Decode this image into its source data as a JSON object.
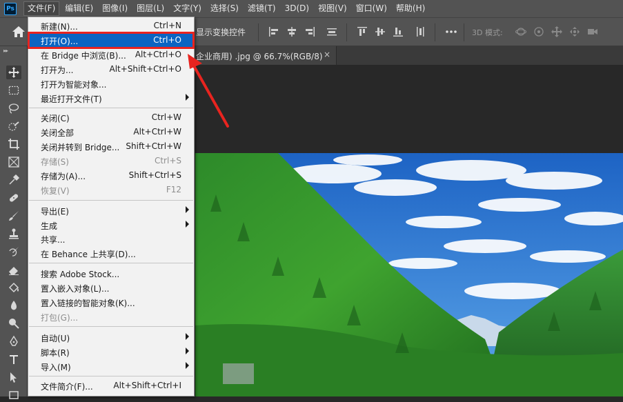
{
  "app": {
    "logo_text": "Ps"
  },
  "menubar": {
    "items": [
      "文件(F)",
      "编辑(E)",
      "图像(I)",
      "图层(L)",
      "文字(Y)",
      "选择(S)",
      "滤镜(T)",
      "3D(D)",
      "视图(V)",
      "窗口(W)",
      "帮助(H)"
    ],
    "active_index": 0
  },
  "options": {
    "transform_controls_label": "显示变换控件",
    "threed_mode_label": "3D 模式:"
  },
  "document_tab": {
    "title": "企业商用) .jpg @ 66.7%(RGB/8)",
    "close_label": "×"
  },
  "file_menu": {
    "items": [
      {
        "label": "新建(N)...",
        "shortcut": "Ctrl+N"
      },
      {
        "label": "打开(O)...",
        "shortcut": "Ctrl+O",
        "highlighted": true
      },
      {
        "label": "在 Bridge 中浏览(B)...",
        "shortcut": "Alt+Ctrl+O"
      },
      {
        "label": "打开为...",
        "shortcut": "Alt+Shift+Ctrl+O"
      },
      {
        "label": "打开为智能对象...",
        "shortcut": ""
      },
      {
        "label": "最近打开文件(T)",
        "shortcut": "",
        "submenu": true
      },
      {
        "label": "关闭(C)",
        "shortcut": "Ctrl+W"
      },
      {
        "label": "关闭全部",
        "shortcut": "Alt+Ctrl+W"
      },
      {
        "label": "关闭并转到 Bridge...",
        "shortcut": "Shift+Ctrl+W"
      },
      {
        "label": "存储(S)",
        "shortcut": "Ctrl+S",
        "disabled": true
      },
      {
        "label": "存储为(A)...",
        "shortcut": "Shift+Ctrl+S"
      },
      {
        "label": "恢复(V)",
        "shortcut": "F12",
        "disabled": true
      },
      {
        "label": "导出(E)",
        "shortcut": "",
        "submenu": true
      },
      {
        "label": "生成",
        "shortcut": "",
        "submenu": true
      },
      {
        "label": "共享...",
        "shortcut": ""
      },
      {
        "label": "在 Behance 上共享(D)...",
        "shortcut": ""
      },
      {
        "label": "搜索 Adobe Stock...",
        "shortcut": ""
      },
      {
        "label": "置入嵌入对象(L)...",
        "shortcut": ""
      },
      {
        "label": "置入链接的智能对象(K)...",
        "shortcut": ""
      },
      {
        "label": "打包(G)...",
        "shortcut": "",
        "disabled": true
      },
      {
        "label": "自动(U)",
        "shortcut": "",
        "submenu": true
      },
      {
        "label": "脚本(R)",
        "shortcut": "",
        "submenu": true
      },
      {
        "label": "导入(M)",
        "shortcut": "",
        "submenu": true
      },
      {
        "label": "文件简介(F)...",
        "shortcut": "Alt+Shift+Ctrl+I"
      }
    ]
  },
  "colors": {
    "highlight_bg": "#0a64c2",
    "annotation_red": "#e8241f"
  }
}
